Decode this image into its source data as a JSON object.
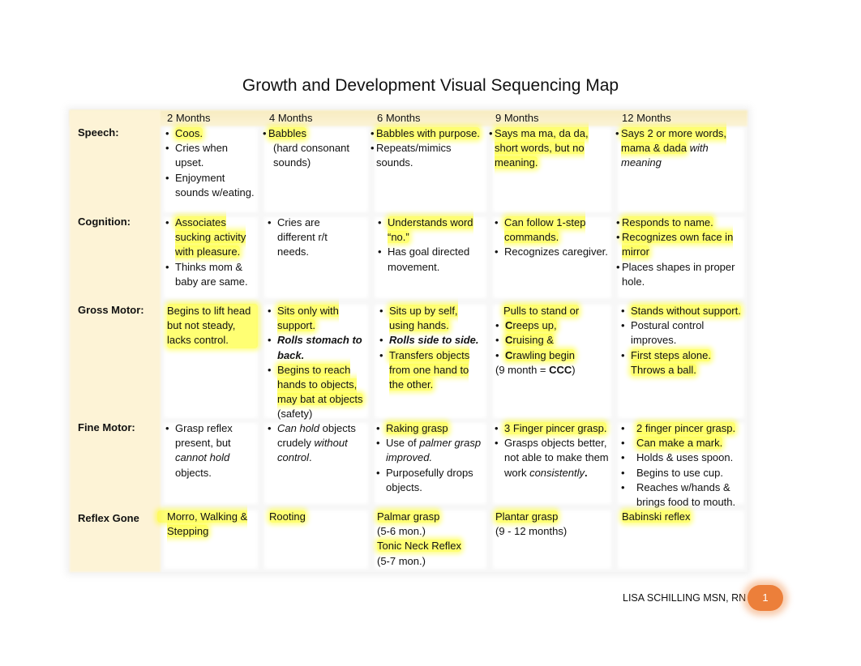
{
  "title": "Growth and Development Visual Sequencing Map",
  "columns": [
    "2 Months",
    "4 Months",
    "6 Months",
    "9 Months",
    "12 Months"
  ],
  "rows": [
    {
      "label": "Speech:",
      "cells": [
        [
          "Coos.",
          "Cries when upset.",
          "Enjoyment sounds w/eating."
        ],
        [
          "Babbles",
          "(hard consonant sounds)"
        ],
        [
          "Babbles with purpose.",
          "Repeats/mimics sounds."
        ],
        [
          "Says ma ma, da da, short words, but no meaning."
        ],
        [
          "Says 2 or more words, mama & dada",
          "with meaning"
        ]
      ]
    },
    {
      "label": "Cognition:",
      "cells": [
        [
          "Associates sucking activity with pleasure.",
          "Thinks mom & baby are same."
        ],
        [
          "Cries are different r/t needs."
        ],
        [
          "Understands word “no.”",
          "Has goal directed movement."
        ],
        [
          "Can follow  1-step commands.",
          "Recognizes caregiver."
        ],
        [
          "Responds to name.",
          "Recognizes own face in mirror",
          "Places shapes in proper hole."
        ]
      ]
    },
    {
      "label": "Gross Motor:",
      "cells": [
        [
          "Begins to lift head but not steady, lacks control."
        ],
        [
          "Sits only with support.",
          "Rolls stomach to back.",
          "Begins to reach hands to objects, may bat at objects",
          "(safety)"
        ],
        [
          "Sits up by self, using hands.",
          "Rolls side to side.",
          "Transfers objects from one hand to the other."
        ],
        [
          "Pulls to stand or",
          "C",
          "reeps up,",
          "C",
          "ruising &",
          "C",
          "rawling begin",
          "(9 month = ",
          "CCC",
          ")"
        ],
        [
          "Stands without support.",
          " Postural control improves.",
          "First steps alone.",
          "Throws a ball."
        ]
      ]
    },
    {
      "label": "Fine Motor:",
      "cells": [
        [
          "Grasp reflex present, but",
          "cannot hold",
          "objects."
        ],
        [
          "Can hold",
          "objects crudely",
          "without control",
          "."
        ],
        [
          "Raking grasp",
          "Use of",
          "palmer grasp improved.",
          "Purposefully drops objects."
        ],
        [
          "3 Finger pincer grasp.",
          "Grasps objects better, not able to make them work",
          "consistently",
          "."
        ],
        [
          "2 finger pincer grasp.",
          "Can make a mark.",
          "Holds & uses spoon.",
          "Begins to use cup.",
          "Reaches w/hands & brings food to mouth."
        ]
      ]
    },
    {
      "label": "Reflex Gone",
      "cells": [
        [
          "Morro, Walking & Stepping"
        ],
        [
          "Rooting"
        ],
        [
          "Palmar grasp",
          "(5-6 mon.)",
          "Tonic Neck Reflex",
          "(5-7 mon.)"
        ],
        [
          "Plantar grasp",
          "(9 - 12 months)"
        ],
        [
          "Babinski reflex"
        ]
      ]
    }
  ],
  "footer": {
    "author": "LISA SCHILLING MSN, RN",
    "page_number": "1"
  },
  "colors": {
    "highlight": "#ffff00",
    "label_column": "#fdf3d6",
    "page_badge": "#ec7f3a"
  }
}
